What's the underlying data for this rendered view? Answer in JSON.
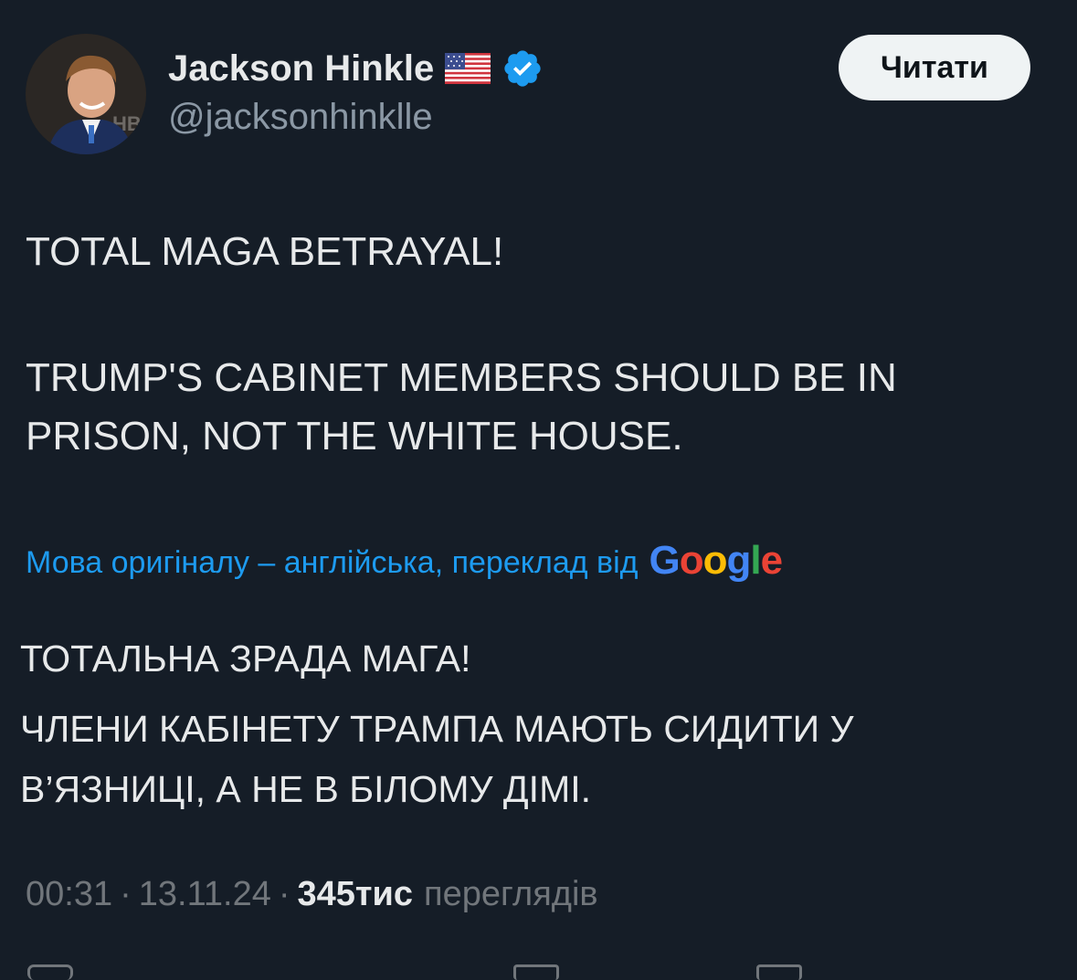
{
  "author": {
    "display_name": "Jackson Hinkle",
    "handle": "@jacksonhinklle",
    "flag": "us-flag-icon",
    "verified": true
  },
  "follow_button": {
    "label": "Читати"
  },
  "tweet": {
    "line1": "TOTAL MAGA BETRAYAL!",
    "line2": "TRUMP'S CABINET MEMBERS SHOULD BE IN PRISON, NOT THE WHITE HOUSE."
  },
  "translation": {
    "note": "Мова оригіналу – англійська, переклад від",
    "provider": "Google",
    "line1": "ТОТАЛЬНА ЗРАДА МАГА!",
    "line2": "ЧЛЕНИ КАБІНЕТУ ТРАМПА МАЮТЬ СИДИТИ У В’ЯЗНИЦІ, А НЕ В БІЛОМУ ДІМІ."
  },
  "meta": {
    "time": "00:31",
    "date": "13.11.24",
    "views": "345тис",
    "views_label": "переглядів",
    "separator": "·"
  },
  "colors": {
    "background": "#151d27",
    "text": "#e7e9ea",
    "muted": "#71767b",
    "link": "#1d9bf0",
    "verified": "#1d9bf0"
  }
}
